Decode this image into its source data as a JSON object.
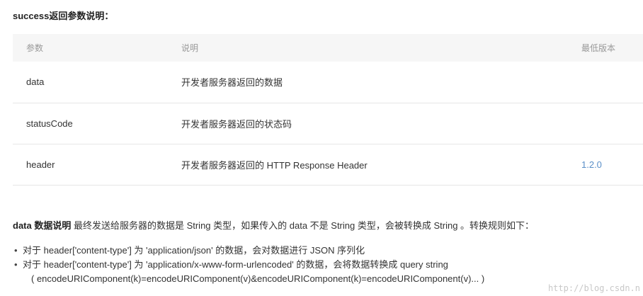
{
  "section_title": "success返回参数说明：",
  "table": {
    "headers": [
      "参数",
      "说明",
      "最低版本"
    ],
    "rows": [
      {
        "param": "data",
        "desc": "开发者服务器返回的数据",
        "version": ""
      },
      {
        "param": "statusCode",
        "desc": "开发者服务器返回的状态码",
        "version": ""
      },
      {
        "param": "header",
        "desc": "开发者服务器返回的 HTTP Response Header",
        "version": "1.2.0"
      }
    ]
  },
  "note": {
    "label": "data 数据说明",
    "text": " 最终发送给服务器的数据是 String 类型，如果传入的 data 不是 String 类型，会被转换成 String 。转换规则如下："
  },
  "bullets": [
    {
      "text": "对于 header['content-type'] 为 'application/json' 的数据，会对数据进行 JSON 序列化",
      "cont": ""
    },
    {
      "text": "对于 header['content-type'] 为 'application/x-www-form-urlencoded' 的数据，会将数据转换成 query string",
      "cont": "( encodeURIComponent(k)=encodeURIComponent(v)&encodeURIComponent(k)=encodeURIComponent(v)... )"
    }
  ],
  "watermark": "http://blog.csdn.n"
}
